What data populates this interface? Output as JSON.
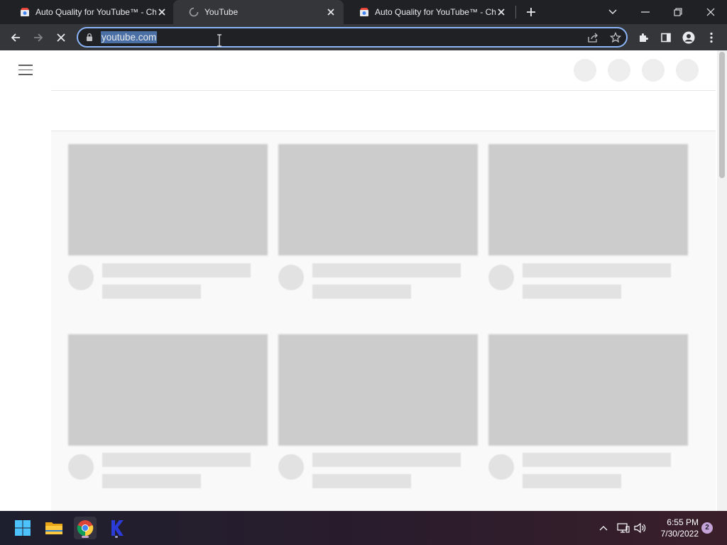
{
  "browser": {
    "tabs": [
      {
        "title": "Auto Quality for YouTube™ - Chr",
        "favicon": "chrome-web-store-icon",
        "active": false
      },
      {
        "title": "YouTube",
        "favicon": "loading-spinner-icon",
        "active": true
      },
      {
        "title": "Auto Quality for YouTube™ - Chr",
        "favicon": "chrome-web-store-icon",
        "active": false
      }
    ],
    "address_bar": {
      "url": "youtube.com",
      "selected": true
    },
    "loading": true
  },
  "page": {
    "state": "loading-skeleton",
    "skeleton_rows": 2,
    "skeleton_columns": 3
  },
  "taskbar": {
    "apps": [
      "start-icon",
      "file-explorer-icon",
      "chrome-icon",
      "k-app-icon"
    ],
    "clock": {
      "time": "6:55 PM",
      "date": "7/30/2022"
    },
    "notification_count": "2"
  },
  "colors": {
    "tab_strip": "#202124",
    "toolbar": "#35363a",
    "omnibox_focus": "#8ab4f8",
    "skeleton_thumb": "#cccccc",
    "skeleton_text": "#e2e2e2"
  }
}
